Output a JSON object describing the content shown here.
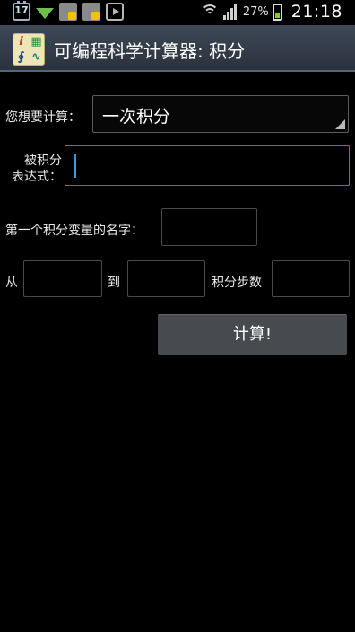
{
  "status_bar": {
    "calendar_day": "17",
    "battery_percent": "27%",
    "time": "21:18",
    "icons": [
      "calendar-icon",
      "download-icon",
      "shopping-bag-icon",
      "shopping-bag-icon",
      "play-store-icon",
      "wifi-icon",
      "signal-icon",
      "battery-charging-icon"
    ]
  },
  "action_bar": {
    "title": "可编程科学计算器: 积分",
    "app_icon_glyphs": [
      "i",
      "▦",
      "∮",
      "∿"
    ]
  },
  "form": {
    "calc_type_label": "您想要计算：",
    "calc_type_value": "一次积分",
    "integrand_label_line1": "被积分",
    "integrand_label_line2": "表达式：",
    "integrand_value": "",
    "variable_label": "第一个积分变量的名字：",
    "variable_value": "",
    "from_label": "从",
    "from_value": "",
    "to_label": "到",
    "to_value": "",
    "steps_label": "积分步数",
    "steps_value": "",
    "calculate_button": "计算!"
  }
}
